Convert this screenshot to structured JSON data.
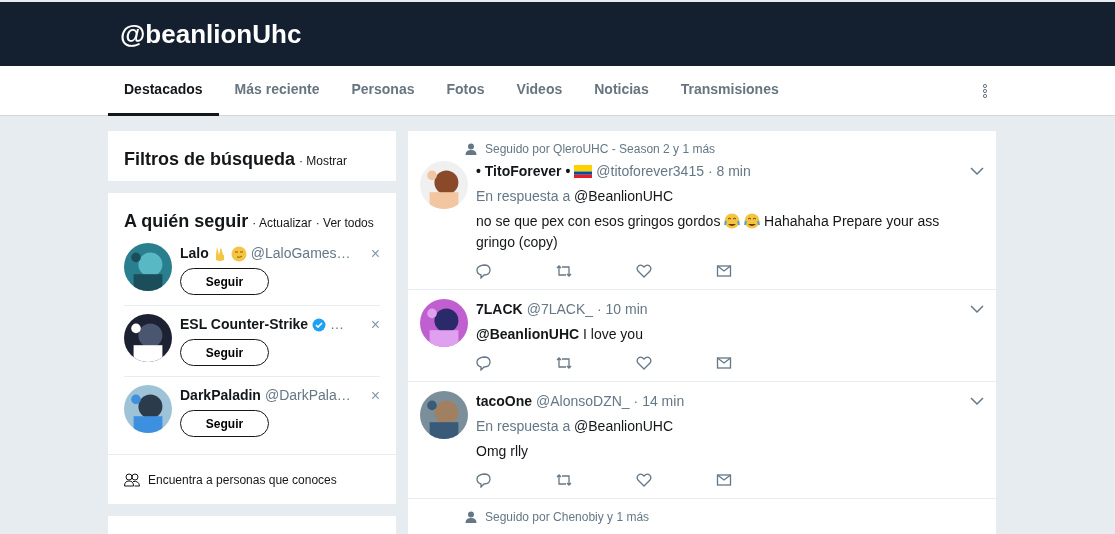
{
  "header": {
    "title": "@beanlionUhc"
  },
  "tabs": [
    {
      "label": "Destacados",
      "selected": true
    },
    {
      "label": "Más reciente",
      "selected": false
    },
    {
      "label": "Personas",
      "selected": false
    },
    {
      "label": "Fotos",
      "selected": false
    },
    {
      "label": "Videos",
      "selected": false
    },
    {
      "label": "Noticias",
      "selected": false
    },
    {
      "label": "Transmisiones",
      "selected": false
    }
  ],
  "filters": {
    "title": "Filtros de búsqueda",
    "action": "· Mostrar"
  },
  "who_to_follow": {
    "title": "A quién seguir",
    "actions": [
      "· Actualizar",
      "· Ver todos"
    ],
    "users": [
      {
        "name": "Lalo",
        "extras": [
          {
            "kind": "victory-hand"
          },
          {
            "kind": "smirk-face"
          }
        ],
        "handle": "@LaloGames…",
        "verified": false,
        "button": "Seguir",
        "dismiss": "×"
      },
      {
        "name": "ESL Counter-Strike",
        "handle": "…",
        "verified": true,
        "button": "Seguir",
        "dismiss": "×"
      },
      {
        "name": "DarkPaladin",
        "handle": "@DarkPala…",
        "verified": false,
        "button": "Seguir",
        "dismiss": "×"
      }
    ],
    "find_people": "Encuentra a personas que conoces"
  },
  "tweets": [
    {
      "context": "Seguido por QleroUHC - Season 2 y 1 más",
      "name": "• TitoForever •",
      "extras": [
        {
          "kind": "flag"
        }
      ],
      "handle": "@titoforever3415",
      "time": "· 8 min",
      "reply_label": "En respuesta a",
      "reply_to": "@BeanlionUHC",
      "body": [
        {
          "kind": "text",
          "text": "no se que pex con esos gringos gordos"
        },
        {
          "kind": "emoji"
        },
        {
          "kind": "emoji"
        },
        {
          "kind": "text",
          "text": "Hahahaha Prepare your ass"
        },
        {
          "kind": "text",
          "text": "gringo (copy)"
        }
      ]
    },
    {
      "name": "7LACK",
      "handle": "@7LACK_",
      "time": "· 10 min",
      "body": [
        {
          "kind": "text",
          "text": "**@BeanlionUHC** I love you"
        }
      ]
    },
    {
      "name": "tacoOne",
      "handle": "@AlonsoDZN_",
      "time": "· 14 min",
      "reply_label": "En respuesta a",
      "reply_to": "@BeanlionUHC",
      "body": [
        {
          "kind": "text",
          "text": "Omg rlly"
        }
      ]
    },
    {
      "context": "Seguido por Chenobiy y 1 más"
    }
  ]
}
